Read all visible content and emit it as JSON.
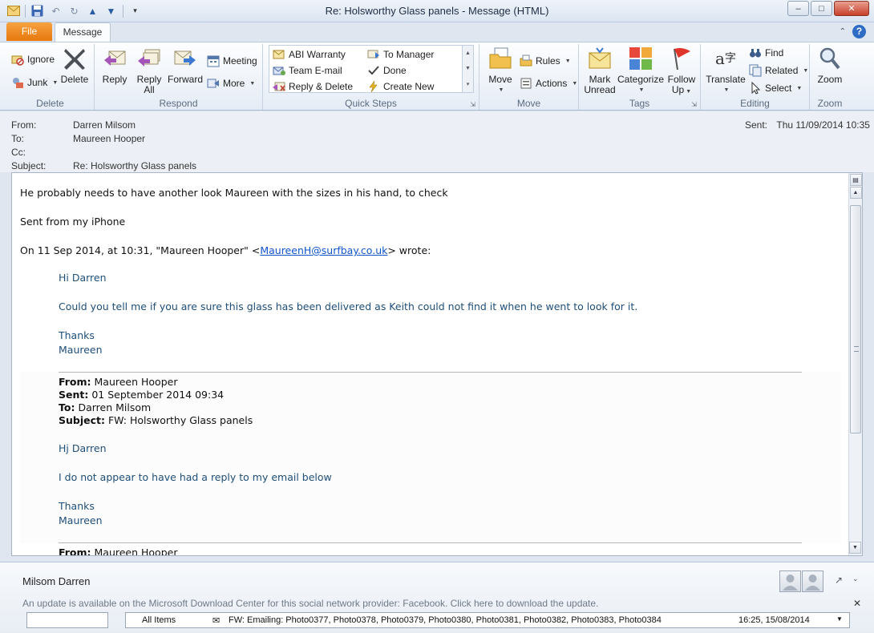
{
  "window": {
    "title": "Re: Holsworthy Glass panels  -  Message (HTML)",
    "minimize": "–",
    "maximize": "□",
    "close": "✕"
  },
  "ribbon_tabs": {
    "file": "File",
    "message": "Message"
  },
  "groups": {
    "delete": {
      "label": "Delete",
      "ignore": "Ignore",
      "junk": "Junk",
      "delete": "Delete"
    },
    "respond": {
      "label": "Respond",
      "reply": "Reply",
      "reply_all_1": "Reply",
      "reply_all_2": "All",
      "forward": "Forward",
      "meeting": "Meeting",
      "more": "More"
    },
    "quick_steps": {
      "label": "Quick Steps",
      "abi_warranty": "ABI Warranty",
      "team_email": "Team E-mail",
      "reply_delete": "Reply & Delete",
      "to_manager": "To Manager",
      "done": "Done",
      "create_new": "Create New"
    },
    "move": {
      "label": "Move",
      "move": "Move",
      "rules": "Rules",
      "actions": "Actions"
    },
    "tags": {
      "label": "Tags",
      "mark_unread_1": "Mark",
      "mark_unread_2": "Unread",
      "categorize": "Categorize",
      "follow_up_1": "Follow",
      "follow_up_2": "Up"
    },
    "editing": {
      "label": "Editing",
      "translate": "Translate",
      "find": "Find",
      "related": "Related",
      "select": "Select"
    },
    "zoom": {
      "label": "Zoom",
      "zoom": "Zoom"
    }
  },
  "headers": {
    "from_label": "From:",
    "from_value": "Darren Milsom",
    "to_label": "To:",
    "to_value": "Maureen Hooper",
    "cc_label": "Cc:",
    "cc_value": "",
    "subject_label": "Subject:",
    "subject_value": "Re: Holsworthy Glass panels",
    "sent_label": "Sent:",
    "sent_value": "Thu 11/09/2014 10:35"
  },
  "message": {
    "line1": "He probably needs to have another look Maureen with the sizes in his hand, to check",
    "line2": "Sent from my iPhone",
    "wrote_prefix": "On 11 Sep 2014, at 10:31, \"Maureen Hooper\" <",
    "wrote_email": "MaureenH@surfbay.co.uk",
    "wrote_suffix": "> wrote:",
    "q1_greeting": "Hi Darren",
    "q1_body": "Could you tell me if you are sure this glass has been delivered as Keith could not find it when he went to look for it.",
    "q1_thanks": "Thanks",
    "q1_name": "Maureen",
    "fwd1_from_label": "From:",
    "fwd1_from": "Maureen Hooper",
    "fwd1_sent_label": "Sent:",
    "fwd1_sent": "01 September 2014 09:34",
    "fwd1_to_label": "To:",
    "fwd1_to": "Darren Milsom",
    "fwd1_subject_label": "Subject:",
    "fwd1_subject": "FW: Holsworthy Glass panels",
    "q2_greeting": "Hj Darren",
    "q2_body": "I do not appear to have had a reply to my email below",
    "q2_thanks": "Thanks",
    "q2_name": "Maureen",
    "fwd2_from_label": "From:",
    "fwd2_from": "Maureen Hooper"
  },
  "people_pane": {
    "name": "Milsom Darren",
    "notice": "An update is available on the Microsoft Download Center for this social network provider: Facebook. Click here to download the update.",
    "all_items": "All Items",
    "feed_item": "FW: Emailing: Photo0377, Photo0378, Photo0379, Photo0380, Photo0381, Photo0382, Photo0383, Photo0384",
    "feed_time": "16:25, 15/08/2014"
  },
  "colors": {
    "file_tab": "#e7770d",
    "quote_text": "#1f4e79",
    "link": "#1155cc",
    "close_button": "#c8402a"
  }
}
